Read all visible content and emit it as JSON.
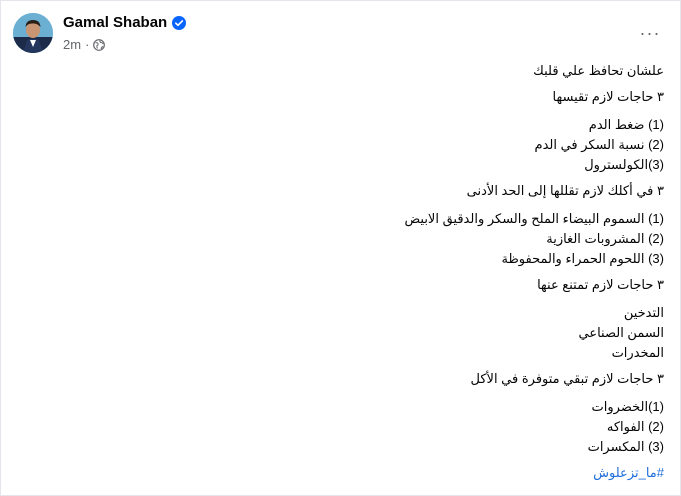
{
  "post": {
    "author": "Gamal Shaban",
    "time": "2m",
    "dot": "·",
    "more_label": "···"
  },
  "content": {
    "lines": [
      "علشان تحافظ علي قلبك",
      "٣ حاجات لازم تقيسها",
      "(1) ضغط الدم",
      "(2) نسبة السكر في الدم",
      "(3)الكولسترول",
      "٣  في أكلك لازم تقللها إلى الحد الأدنى",
      "(1) السموم البيضاء الملح والسكر والدقيق الابيض",
      "(2) المشروبات الغازية",
      "(3) اللحوم الحمراء والمحفوظة",
      "٣ حاجات لازم تمتنع عنها",
      "التدخين",
      "السمن الصناعي",
      "المخدرات",
      "٣ حاجات لازم تبقي متوفرة  في الأكل",
      "(1)الخضروات",
      "(2) الفواكه",
      "(3) المكسرات"
    ],
    "hashtag": "#ما_تزعلوش"
  },
  "colors": {
    "verified": "#0866ff",
    "link": "#216fdb",
    "secondary_text": "#65676b"
  },
  "icons": {
    "verified": "verified-badge-icon",
    "audience": "globe-icon",
    "more": "more-options-icon"
  }
}
